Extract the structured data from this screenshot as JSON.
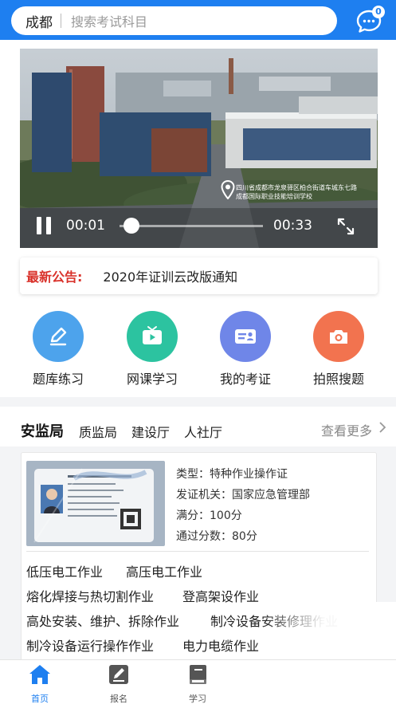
{
  "header": {
    "city": "成都",
    "search_placeholder": "搜索考试科目",
    "message_badge": "0",
    "bg_color": "#1e7ff0"
  },
  "video": {
    "current_time": "00:01",
    "total_time": "00:33",
    "progress": 0.03,
    "location_text": "四川省成都市龙泉驿区柏合街道车城东七路 成都国际职业技能培训学校"
  },
  "notice": {
    "tag": "最新公告:",
    "text": "2020年证训云改版通知",
    "tag_color": "#d9322b"
  },
  "quick_menu": [
    {
      "label": "题库练习",
      "icon": "pencil-icon",
      "color": "#4da3ec"
    },
    {
      "label": "网课学习",
      "icon": "tv-icon",
      "color": "#2cc3a0"
    },
    {
      "label": "我的考证",
      "icon": "id-card-icon",
      "color": "#6f86e8"
    },
    {
      "label": "拍照搜题",
      "icon": "camera-icon",
      "color": "#f2734f"
    }
  ],
  "bureau_tabs": {
    "active": "安监局",
    "others": [
      "质监局",
      "建设厅",
      "人社厅"
    ],
    "more_label": "查看更多"
  },
  "certificate": {
    "type_line": "类型：特种作业操作证",
    "issuer_line": "发证机关：国家应急管理部",
    "full_score_line": "满分：100分",
    "pass_score_line": "通过分数：80分",
    "jobs": [
      [
        "低压电工作业",
        "高压电工作业"
      ],
      [
        "熔化焊接与热切割作业",
        "登高架设作业"
      ],
      [
        "高处安装、维护、拆除作业",
        "制冷设备安装修理作业"
      ],
      [
        "制冷设备运行操作作业",
        "电力电缆作业"
      ]
    ]
  },
  "bottom_nav": [
    {
      "label": "首页",
      "icon": "home-icon",
      "active": true
    },
    {
      "label": "报名",
      "icon": "signup-icon",
      "active": false
    },
    {
      "label": "学习",
      "icon": "book-icon",
      "active": false
    }
  ],
  "colors": {
    "active_nav": "#1e7ff0",
    "inactive_nav": "#555555"
  }
}
